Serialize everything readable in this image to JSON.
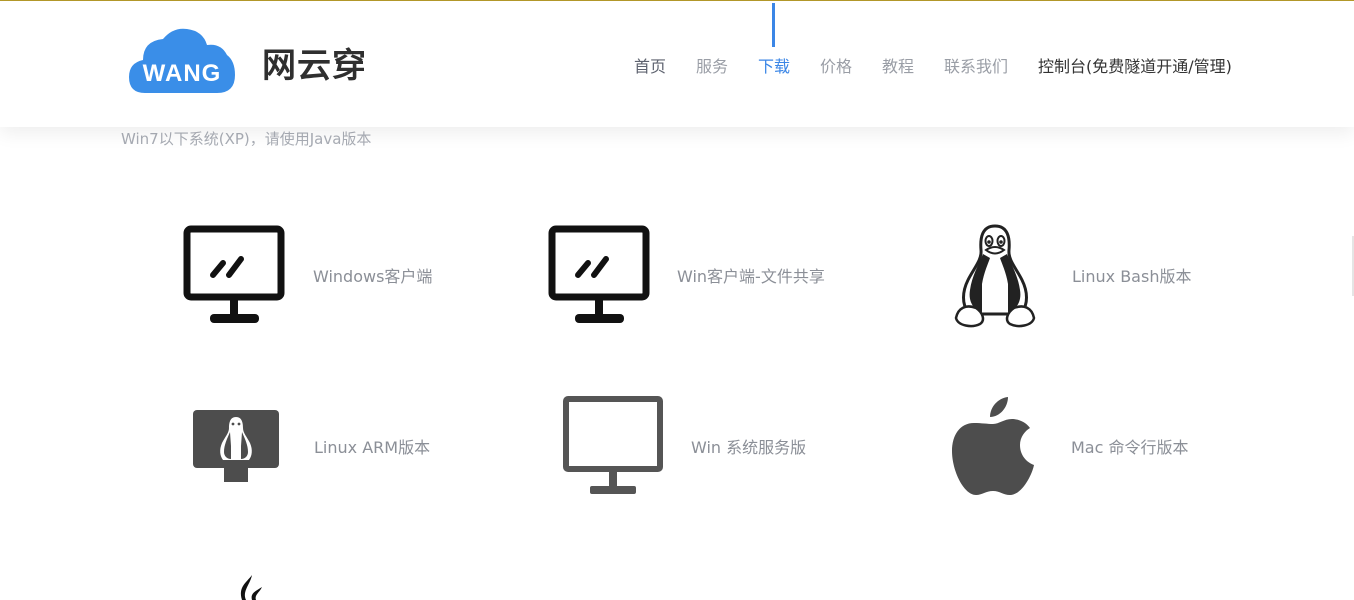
{
  "header": {
    "logo_text": "WANG",
    "brand": "网云穿",
    "nav": [
      {
        "label": "首页"
      },
      {
        "label": "服务"
      },
      {
        "label": "下载"
      },
      {
        "label": "价格"
      },
      {
        "label": "教程"
      },
      {
        "label": "联系我们"
      },
      {
        "label": "控制台(免费隧道开通/管理)"
      }
    ],
    "active_nav": "下载"
  },
  "main": {
    "note": "Win7以下系统(XP)，请使用Java版本",
    "downloads": [
      {
        "label": "Windows客户端",
        "icon": "monitor-icon"
      },
      {
        "label": "Win客户端-文件共享",
        "icon": "monitor-icon"
      },
      {
        "label": "Linux  Bash版本",
        "icon": "linux-tux-icon"
      },
      {
        "label": "Linux  ARM版本",
        "icon": "linux-monitor-icon"
      },
      {
        "label": "Win  系统服务版",
        "icon": "monitor-outline-icon"
      },
      {
        "label": "Mac  命令行版本",
        "icon": "apple-icon"
      }
    ]
  },
  "colors": {
    "accent": "#3b86e6",
    "logo": "#3a8ee8",
    "icon": "#111111",
    "icon_gray": "#4d4d4d"
  }
}
